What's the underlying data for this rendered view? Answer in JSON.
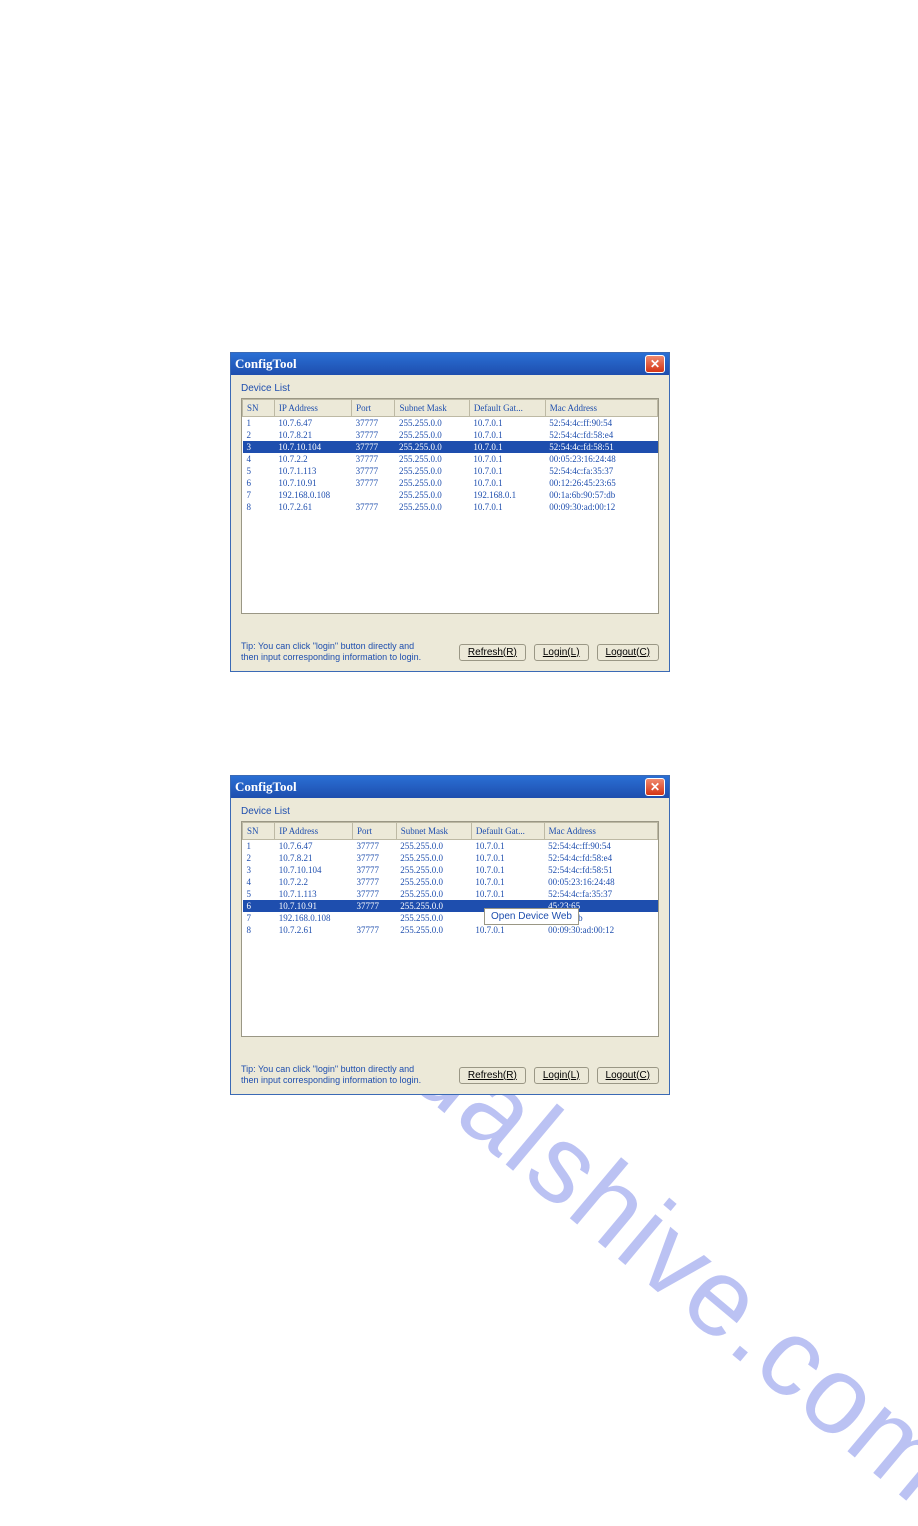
{
  "title": "ConfigTool",
  "device_list_label": "Device List",
  "cols": [
    "SN",
    "IP Address",
    "Port",
    "Subnet Mask",
    "Default Gat...",
    "Mac Address"
  ],
  "rows": [
    {
      "sn": "1",
      "ip": "10.7.6.47",
      "port": "37777",
      "sm": "255.255.0.0",
      "gw": "10.7.0.1",
      "mac": "52:54:4c:ff:90:54"
    },
    {
      "sn": "2",
      "ip": "10.7.8.21",
      "port": "37777",
      "sm": "255.255.0.0",
      "gw": "10.7.0.1",
      "mac": "52:54:4c:fd:58:e4"
    },
    {
      "sn": "3",
      "ip": "10.7.10.104",
      "port": "37777",
      "sm": "255.255.0.0",
      "gw": "10.7.0.1",
      "mac": "52:54:4c:fd:58:51"
    },
    {
      "sn": "4",
      "ip": "10.7.2.2",
      "port": "37777",
      "sm": "255.255.0.0",
      "gw": "10.7.0.1",
      "mac": "00:05:23:16:24:48"
    },
    {
      "sn": "5",
      "ip": "10.7.1.113",
      "port": "37777",
      "sm": "255.255.0.0",
      "gw": "10.7.0.1",
      "mac": "52:54:4c:fa:35:37"
    },
    {
      "sn": "6",
      "ip": "10.7.10.91",
      "port": "37777",
      "sm": "255.255.0.0",
      "gw": "10.7.0.1",
      "mac": "00:12:26:45:23:65"
    },
    {
      "sn": "7",
      "ip": "192.168.0.108",
      "port": "",
      "sm": "255.255.0.0",
      "gw": "192.168.0.1",
      "mac": "00:1a:6b:90:57:db"
    },
    {
      "sn": "8",
      "ip": "10.7.2.61",
      "port": "37777",
      "sm": "255.255.0.0",
      "gw": "10.7.0.1",
      "mac": "00:09:30:ad:00:12"
    }
  ],
  "rows2": [
    {
      "sn": "1",
      "ip": "10.7.6.47",
      "port": "37777",
      "sm": "255.255.0.0",
      "gw": "10.7.0.1",
      "mac": "52:54:4c:ff:90:54"
    },
    {
      "sn": "2",
      "ip": "10.7.8.21",
      "port": "37777",
      "sm": "255.255.0.0",
      "gw": "10.7.0.1",
      "mac": "52:54:4c:fd:58:e4"
    },
    {
      "sn": "3",
      "ip": "10.7.10.104",
      "port": "37777",
      "sm": "255.255.0.0",
      "gw": "10.7.0.1",
      "mac": "52:54:4c:fd:58:51"
    },
    {
      "sn": "4",
      "ip": "10.7.2.2",
      "port": "37777",
      "sm": "255.255.0.0",
      "gw": "10.7.0.1",
      "mac": "00:05:23:16:24:48"
    },
    {
      "sn": "5",
      "ip": "10.7.1.113",
      "port": "37777",
      "sm": "255.255.0.0",
      "gw": "10.7.0.1",
      "mac": "52:54:4c:fa:35:37"
    },
    {
      "sn": "6",
      "ip": "10.7.10.91",
      "port": "37777",
      "sm": "255.255.0.0",
      "gw": "",
      "mac": "45:23:65"
    },
    {
      "sn": "7",
      "ip": "192.168.0.108",
      "port": "",
      "sm": "255.255.0.0",
      "gw": "",
      "mac": ":90:57:db"
    },
    {
      "sn": "8",
      "ip": "10.7.2.61",
      "port": "37777",
      "sm": "255.255.0.0",
      "gw": "10.7.0.1",
      "mac": "00:09:30:ad:00:12"
    }
  ],
  "sel1": 2,
  "sel2": 5,
  "tip": "Tip: You can click \"login\" button directly and\nthen input corresponding information to login.",
  "btn_refresh": "Refresh(R)",
  "btn_login": "Login(L)",
  "btn_logout": "Logout(C)",
  "context_menu": "Open Device Web",
  "watermark": "manualshive.com"
}
